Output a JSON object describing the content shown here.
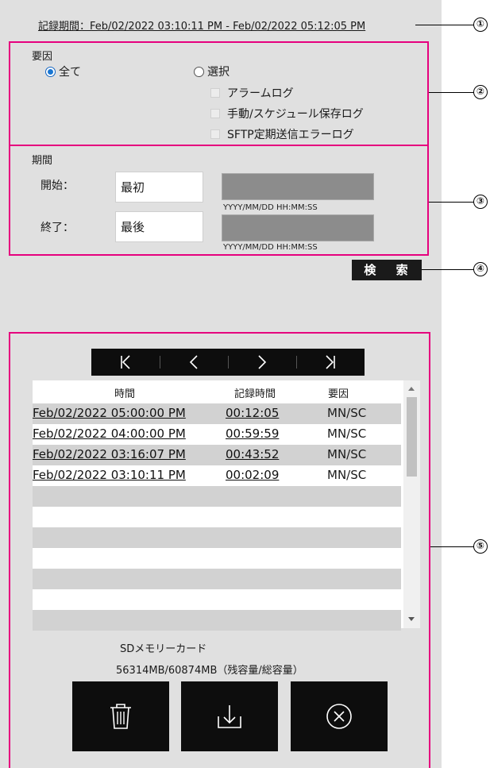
{
  "header": {
    "record_period": "記録期間：Feb/02/2022 03:10:11 PM - Feb/02/2022 05:12:05 PM"
  },
  "callouts": [
    "①",
    "②",
    "③",
    "④",
    "⑤"
  ],
  "cause": {
    "label": "要因",
    "radio_all": "全て",
    "radio_select": "選択",
    "selected": "all",
    "checkboxes": [
      "アラームログ",
      "手動/スケジュール保存ログ",
      "SFTP定期送信エラーログ"
    ]
  },
  "range": {
    "label": "期間",
    "start_label": "開始：",
    "start_value": "最初",
    "end_label": "終了：",
    "end_value": "最後",
    "format_hint": "YYYY/MM/DD HH:MM:SS"
  },
  "search_button": "検 索",
  "pager_icons": [
    "first-page-icon",
    "prev-page-icon",
    "next-page-icon",
    "last-page-icon"
  ],
  "table": {
    "headers": [
      "時間",
      "記録時間",
      "要因"
    ],
    "rows": [
      {
        "time": "Feb/02/2022  05:00:00 PM",
        "duration": "00:12:05",
        "cause": "MN/SC"
      },
      {
        "time": "Feb/02/2022  04:00:00 PM",
        "duration": "00:59:59",
        "cause": "MN/SC"
      },
      {
        "time": "Feb/02/2022  03:16:07 PM",
        "duration": "00:43:52",
        "cause": "MN/SC"
      },
      {
        "time": "Feb/02/2022  03:10:11 PM",
        "duration": "00:02:09",
        "cause": "MN/SC"
      }
    ],
    "empty_rows": 7
  },
  "sd": {
    "title": "SDメモリーカード",
    "capacity": "56314MB/60874MB（残容量/総容量）"
  },
  "action_icons": [
    "trash-icon",
    "download-icon",
    "cancel-circle-icon"
  ],
  "colors": {
    "highlight": "#e6007e",
    "panel_bg": "#e0e0e0",
    "button_bg": "#0d0d0d"
  }
}
